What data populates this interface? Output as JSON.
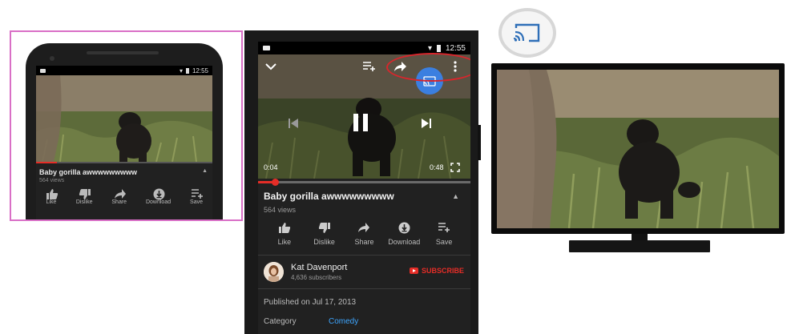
{
  "small_phone": {
    "status_time": "12:55",
    "video_title": "Baby gorilla awwwwwwwww",
    "views": "564 views",
    "progress_fraction": 0.12,
    "actions": [
      {
        "label": "Like",
        "icon": "thumbs-up-icon"
      },
      {
        "label": "Dislike",
        "icon": "thumbs-down-icon"
      },
      {
        "label": "Share",
        "icon": "share-icon"
      },
      {
        "label": "Download",
        "icon": "download-icon"
      },
      {
        "label": "Save",
        "icon": "save-to-playlist-icon"
      }
    ]
  },
  "main_phone": {
    "status_time": "12:55",
    "current_time": "0:04",
    "duration": "0:48",
    "progress_fraction": 0.08,
    "video_title": "Baby gorilla awwwwwwwww",
    "views": "564 views",
    "actions": [
      {
        "label": "Like",
        "icon": "thumbs-up-icon"
      },
      {
        "label": "Dislike",
        "icon": "thumbs-down-icon"
      },
      {
        "label": "Share",
        "icon": "share-icon"
      },
      {
        "label": "Download",
        "icon": "download-icon"
      },
      {
        "label": "Save",
        "icon": "save-to-playlist-icon"
      }
    ],
    "channel": {
      "name": "Kat Davenport",
      "subscribers": "4,636 subscribers",
      "subscribe_label": "SUBSCRIBE"
    },
    "published": "Published on Jul 17, 2013",
    "category_label": "Category",
    "category_value": "Comedy"
  },
  "colors": {
    "accent_red": "#e52d27",
    "cast_blue": "#3b7fe0",
    "link_blue": "#3ea6ff",
    "frame_pink": "#d96fc6"
  }
}
